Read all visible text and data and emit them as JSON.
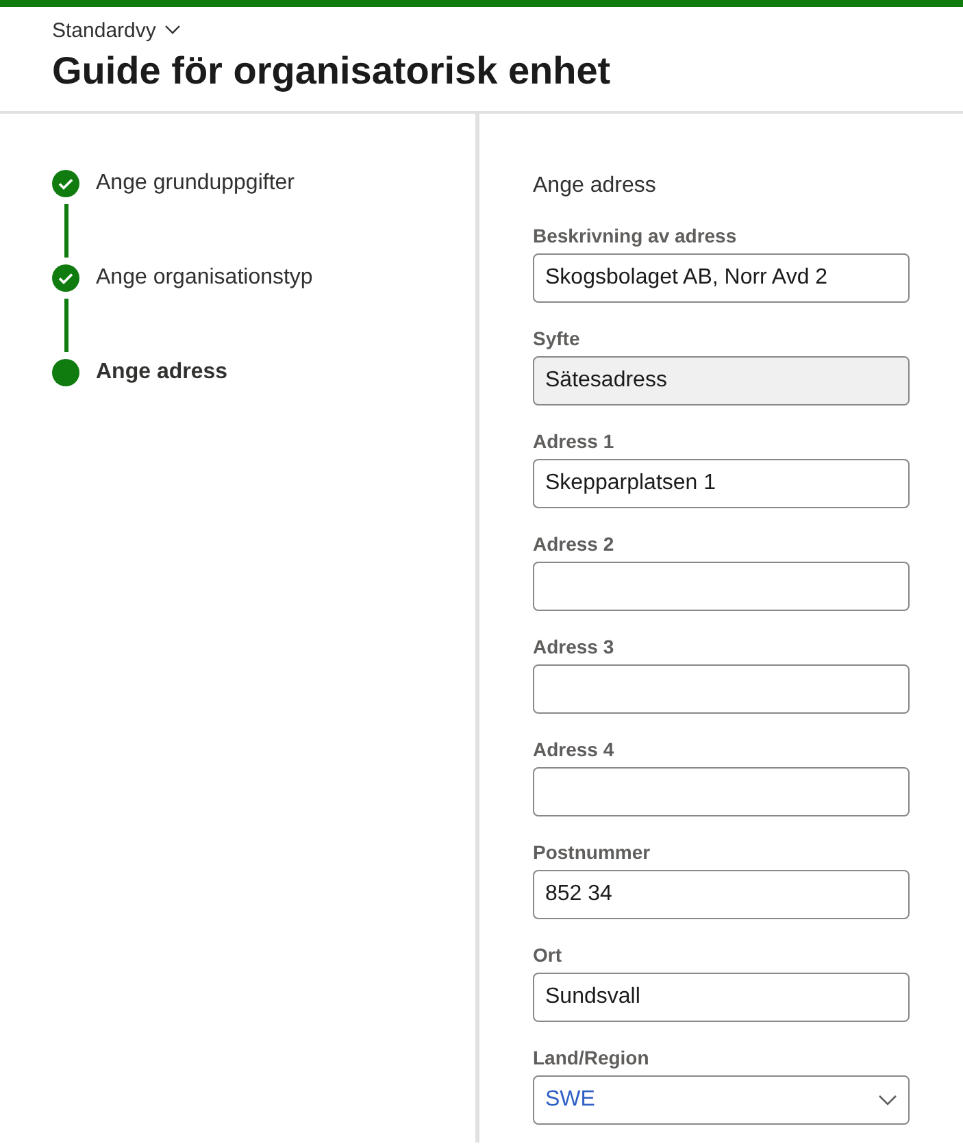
{
  "header": {
    "view_selector": "Standardvy",
    "title": "Guide för organisatorisk enhet"
  },
  "steps": [
    {
      "label": "Ange grunduppgifter",
      "kind": "done",
      "selected": false
    },
    {
      "label": "Ange organisationstyp",
      "kind": "done",
      "selected": false
    },
    {
      "label": "Ange adress",
      "kind": "current",
      "selected": true
    }
  ],
  "form": {
    "section_title": "Ange adress",
    "fields": [
      {
        "label": "Beskrivning av adress",
        "kind": "text",
        "value": "Skogsbolaget AB, Norr Avd 2"
      },
      {
        "label": "Syfte",
        "kind": "readonly",
        "value": "Sätesadress"
      },
      {
        "label": "Adress 1",
        "kind": "text",
        "value": "Skepparplatsen 1"
      },
      {
        "label": "Adress 2",
        "kind": "text"
      },
      {
        "label": "Adress 3",
        "kind": "text"
      },
      {
        "label": "Adress 4",
        "kind": "text"
      },
      {
        "label": "Postnummer",
        "kind": "text",
        "value": "852 34"
      },
      {
        "label": "Ort",
        "kind": "text",
        "value": "Sundsvall"
      },
      {
        "label": "Land/Region",
        "kind": "select",
        "value": "SWE"
      }
    ]
  }
}
